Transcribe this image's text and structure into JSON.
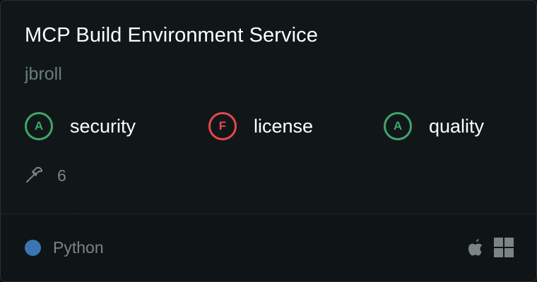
{
  "card": {
    "title": "MCP Build Environment Service",
    "author": "jbroll",
    "grades": [
      {
        "grade": "A",
        "label": "security",
        "color": "#3fa66c"
      },
      {
        "grade": "F",
        "label": "license",
        "color": "#e5484d"
      },
      {
        "grade": "A",
        "label": "quality",
        "color": "#3fa66c"
      }
    ],
    "tools": {
      "icon": "hammer-icon",
      "count": "6"
    },
    "language": {
      "name": "Python",
      "color": "#3a76b0"
    },
    "platforms": [
      "apple-icon",
      "windows-icon"
    ]
  }
}
